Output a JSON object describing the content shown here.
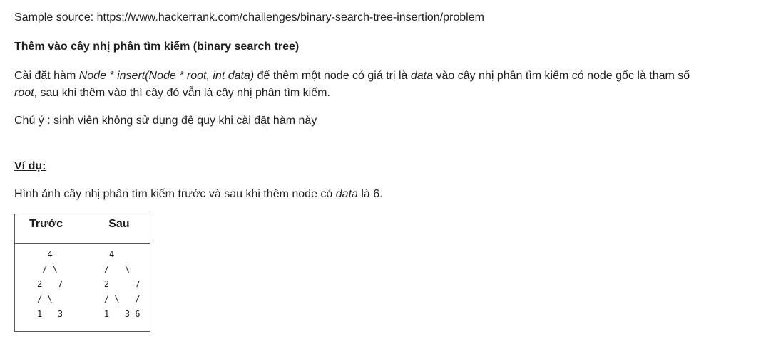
{
  "source": {
    "text": "Sample source: https://www.hackerrank.com/challenges/binary-search-tree-insertion/problem"
  },
  "title": "Thêm vào cây nhị phân tìm kiếm (binary search tree)",
  "description": {
    "part1": "Cài đặt hàm ",
    "signature": "Node * insert(Node * root, int data)",
    "part2": " để thêm một node có giá trị là ",
    "data_word": "data",
    "part3": " vào cây nhị phân tìm kiếm có node gốc là tham số ",
    "root_word": "root",
    "part4": ", sau khi thêm vào thì cây đó vẫn là cây nhị phân tìm kiếm."
  },
  "note": "Chú ý : sinh viên không sử dụng đệ quy khi cài đặt hàm này",
  "example": {
    "heading": "Ví dụ:",
    "desc_part1": "Hình ảnh cây nhị phân tìm kiếm trước và sau khi thêm node có ",
    "desc_data": "data",
    "desc_part2": " là 6.",
    "table": {
      "header_before": "Trước",
      "header_after": "Sau",
      "trees": "  4           4\n / \\         /   \\\n2   7        2     7\n/ \\          / \\   /\n1   3        1   3 6"
    }
  }
}
